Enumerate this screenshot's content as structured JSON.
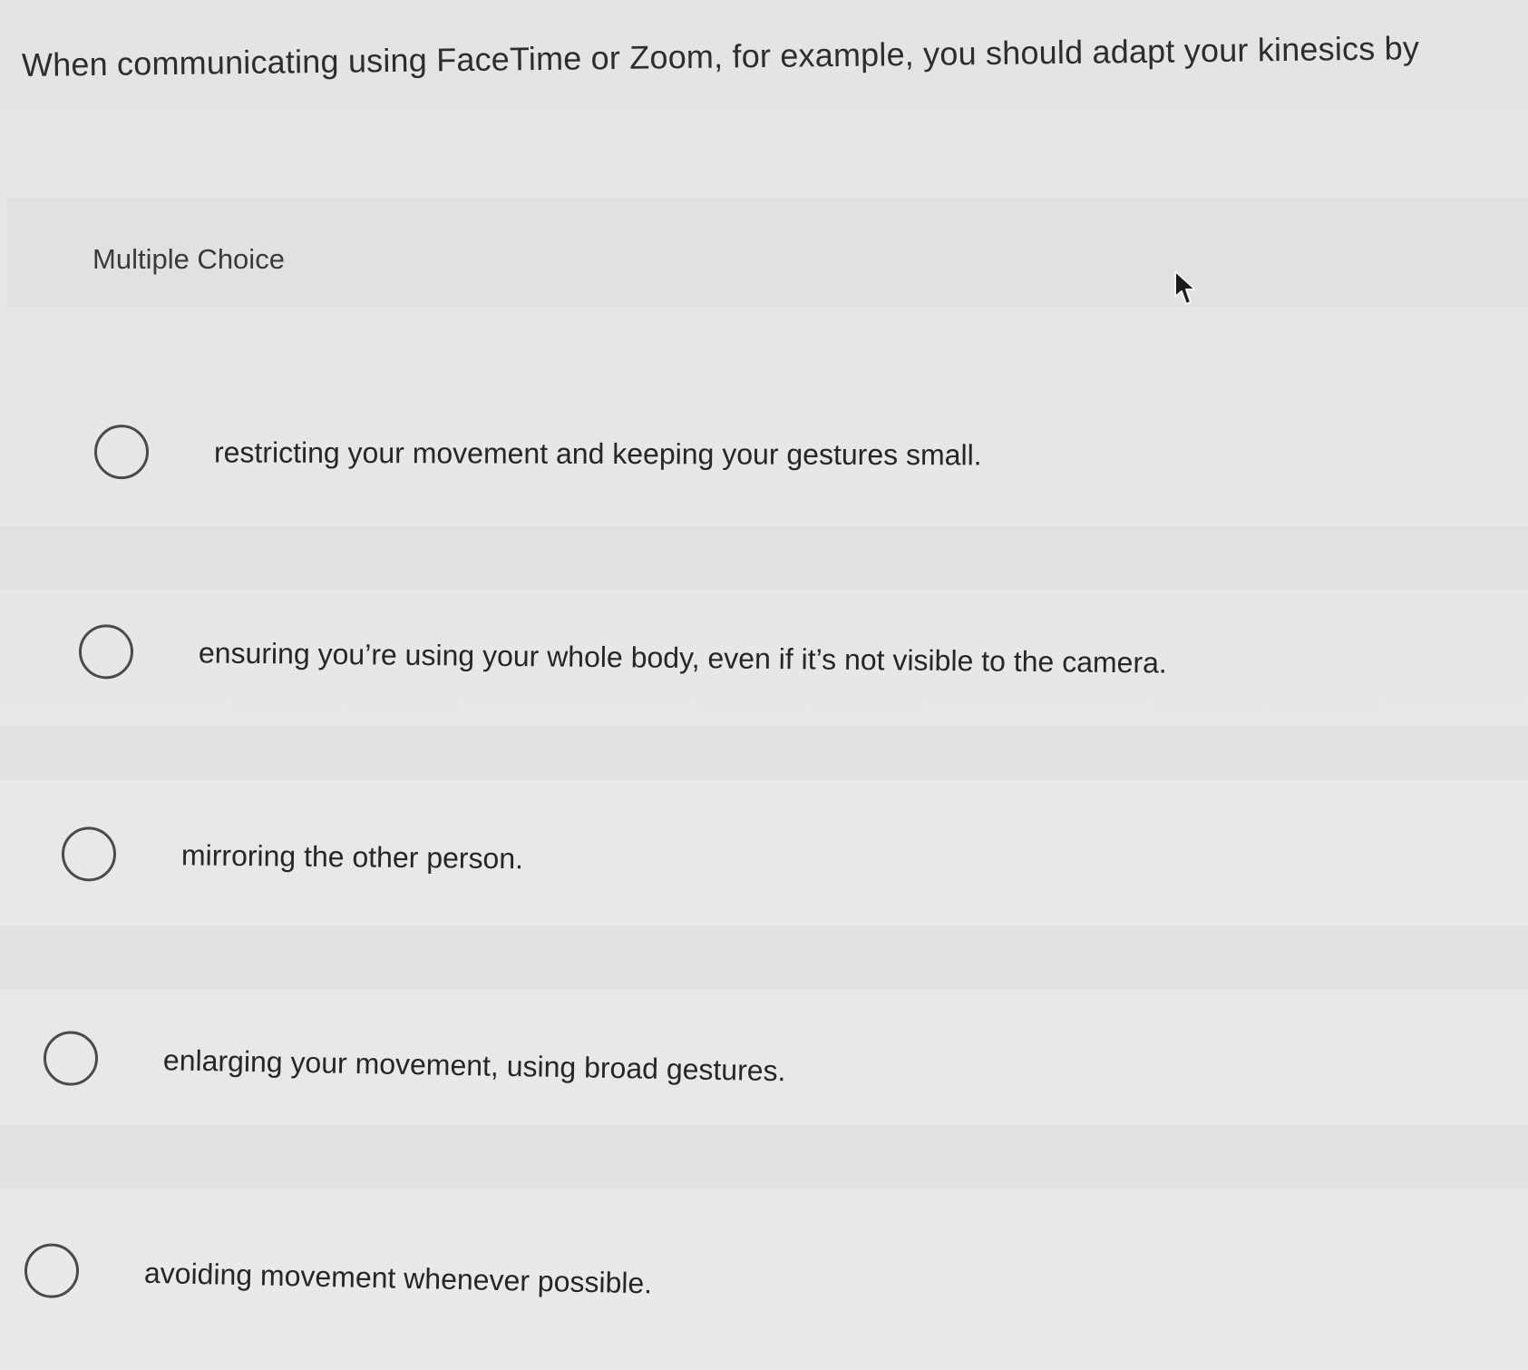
{
  "question": {
    "text": "When communicating using FaceTime or Zoom, for example, you should adapt your kinesics by"
  },
  "section": {
    "label": "Multiple Choice"
  },
  "choices": [
    {
      "label": "restricting your movement and keeping your gestures small."
    },
    {
      "label": "ensuring you’re using your whole body, even if it’s not visible to the camera."
    },
    {
      "label": "mirroring the other person."
    },
    {
      "label": "enlarging your movement, using broad gestures."
    },
    {
      "label": "avoiding movement whenever possible."
    }
  ],
  "icons": {
    "cursor": "mouse-pointer-icon",
    "radio": "radio-unchecked-icon"
  },
  "colors": {
    "background": "#e9e9e9",
    "text": "#2b2b2b",
    "radio_border": "#4a4a4a"
  }
}
